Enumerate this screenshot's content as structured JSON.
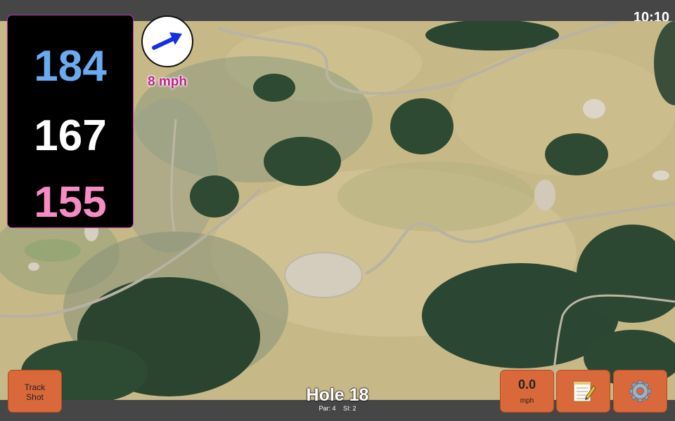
{
  "status_bar": {
    "time": "10:10"
  },
  "distances": {
    "back": "184",
    "middle": "167",
    "front": "155"
  },
  "wind": {
    "speed_label": "8 mph",
    "icon": "wind-arrow-icon"
  },
  "track_button": {
    "line1": "Track",
    "line2": "Shot"
  },
  "speed_button": {
    "value": "0.0",
    "unit": "mph"
  },
  "notes_button": {
    "icon": "notepad-icon"
  },
  "settings_button": {
    "icon": "gear-icon"
  },
  "hole": {
    "title": "Hole 18",
    "par": "Par: 4",
    "si": "SI: 2"
  },
  "colors": {
    "back_distance": "#6aaaf0",
    "middle_distance": "#ffffff",
    "front_distance": "#f78cc4",
    "button_bg": "#d9683a",
    "wind_arrow": "#1530e0",
    "wind_text": "#c0218f"
  }
}
